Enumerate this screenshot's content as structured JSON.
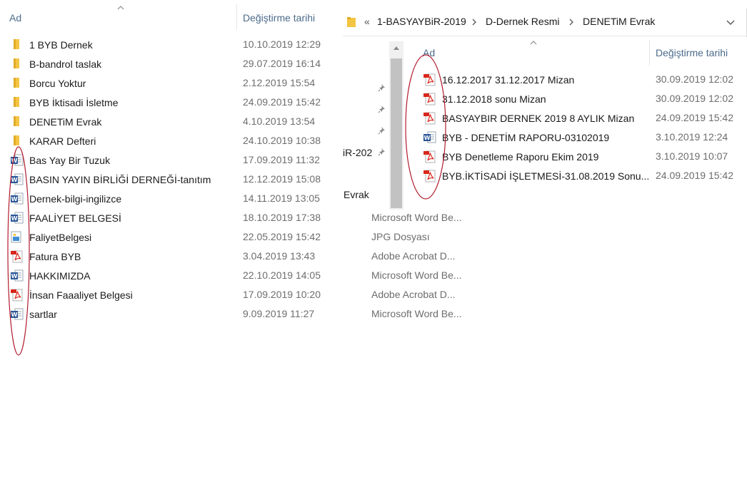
{
  "left_pane": {
    "col_name": "Ad",
    "col_date": "Değiştirme tarihi",
    "rows": [
      {
        "icon": "folder-icon",
        "name": "1 BYB Dernek",
        "date": "10.10.2019 12:29"
      },
      {
        "icon": "folder-icon",
        "name": "B-bandrol taslak",
        "date": "29.07.2019 16:14"
      },
      {
        "icon": "folder-icon",
        "name": "Borcu Yoktur",
        "date": "2.12.2019 15:54"
      },
      {
        "icon": "folder-icon",
        "name": "BYB İktisadi İsletme",
        "date": "24.09.2019 15:42"
      },
      {
        "icon": "folder-icon",
        "name": "DENETiM Evrak",
        "date": "4.10.2019 13:54"
      },
      {
        "icon": "folder-icon",
        "name": "KARAR Defteri",
        "date": "24.10.2019 10:38"
      },
      {
        "icon": "word-icon",
        "name": "Bas Yay Bir Tuzuk",
        "date": "17.09.2019 11:32"
      },
      {
        "icon": "word-icon",
        "name": "BASIN YAYIN BİRLİĞİ DERNEĞİ-tanıtım",
        "date": "12.12.2019 15:08"
      },
      {
        "icon": "word-icon",
        "name": "Dernek-bilgi-ingilizce",
        "date": "14.11.2019 13:05"
      },
      {
        "icon": "word-icon",
        "name": "FAALİYET BELGESİ",
        "date": "18.10.2019 17:38",
        "type": "Microsoft Word Be..."
      },
      {
        "icon": "image-icon",
        "name": "FaliyetBelgesi",
        "date": "22.05.2019 15:42",
        "type": "JPG Dosyası"
      },
      {
        "icon": "pdf-icon",
        "name": "Fatura BYB",
        "date": "3.04.2019 13:43",
        "type": "Adobe Acrobat D..."
      },
      {
        "icon": "word-icon",
        "name": "HAKKIMIZDA",
        "date": "22.10.2019 14:05",
        "type": "Microsoft Word Be..."
      },
      {
        "icon": "pdf-icon",
        "name": "İnsan Faaaliyet Belgesi",
        "date": "17.09.2019 10:20",
        "type": "Adobe Acrobat D..."
      },
      {
        "icon": "word-icon",
        "name": "sartlar",
        "date": "9.09.2019 11:27",
        "type": "Microsoft Word Be..."
      }
    ]
  },
  "right_pane": {
    "breadcrumb": {
      "overflow": "«",
      "items": [
        "1-BASYAYBiR-2019",
        "D-Dernek Resmi",
        "DENETiM Evrak"
      ]
    },
    "nav_fragments": [
      "iR-202",
      "Evrak"
    ],
    "col_name": "Ad",
    "col_date": "Değiştirme tarihi",
    "rows": [
      {
        "icon": "pdf-icon",
        "name": "16.12.2017    31.12.2017 Mizan",
        "date": "30.09.2019 12:02"
      },
      {
        "icon": "pdf-icon",
        "name": "31.12.2018 sonu Mizan",
        "date": "30.09.2019 12:02"
      },
      {
        "icon": "pdf-icon",
        "name": "BASYAYBIR DERNEK 2019 8 AYLIK Mizan",
        "date": "24.09.2019 15:42"
      },
      {
        "icon": "word-icon",
        "name": "BYB - DENETİM RAPORU-03102019",
        "date": "3.10.2019 12:24"
      },
      {
        "icon": "pdf-icon",
        "name": "BYB Denetleme Raporu Ekim 2019",
        "date": "3.10.2019 10:07"
      },
      {
        "icon": "pdf-icon",
        "name": "BYB.İKTİSADİ İŞLETMESİ-31.08.2019 Sonu...",
        "date": "24.09.2019 15:42"
      }
    ]
  },
  "colors": {
    "folder": "#f4c542",
    "word": "#2b5797",
    "pdf": "#d9261c",
    "annotation": "#b01c2e"
  }
}
